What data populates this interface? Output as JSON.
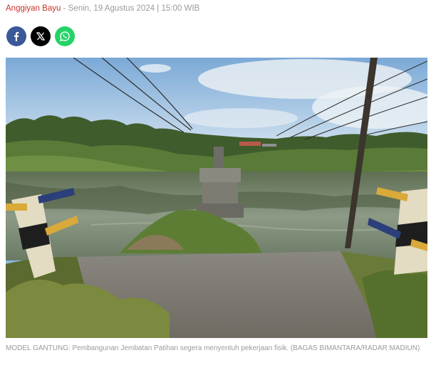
{
  "article": {
    "author": "Anggiyan Bayu",
    "separator": "-",
    "datetime": "Senin, 19 Agustus 2024 | 15:00 WIB"
  },
  "share": {
    "buttons": [
      {
        "network": "facebook",
        "icon": "facebook-icon",
        "color": "#3b5998"
      },
      {
        "network": "x",
        "icon": "x-icon",
        "color": "#000000"
      },
      {
        "network": "whatsapp",
        "icon": "whatsapp-icon",
        "color": "#25d366"
      }
    ]
  },
  "photo": {
    "caption": "MODEL GANTUNG: Pembangunan Jembatan Patihan segera menyentuh pekerjaan fisik. (BAGAS BIMANTARA/RADAR MADIUN)"
  }
}
